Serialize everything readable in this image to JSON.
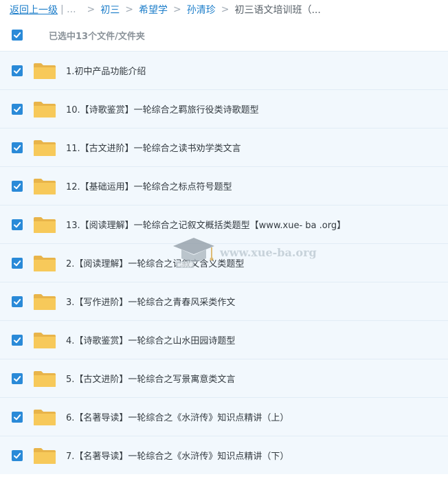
{
  "breadcrumb": {
    "back_label": "返回上一级",
    "ellipsis": "| ...",
    "sep": ">",
    "crumbs": [
      "初三",
      "希望学",
      "孙清珍"
    ],
    "current": "初三语文培训班（..."
  },
  "selection": {
    "label": "已选中13个文件/文件夹"
  },
  "files": [
    {
      "name": "1.初中产品功能介绍"
    },
    {
      "name": "10.【诗歌鉴赏】一轮综合之羁旅行役类诗歌题型"
    },
    {
      "name": "11.【古文进阶】一轮综合之读书劝学类文言"
    },
    {
      "name": "12.【基础运用】一轮综合之标点符号题型"
    },
    {
      "name": "13.【阅读理解】一轮综合之记叙文概括类题型【www.xue- ba .org】"
    },
    {
      "name": "2.【阅读理解】一轮综合之记叙文含义类题型"
    },
    {
      "name": "3.【写作进阶】一轮综合之青春风采类作文"
    },
    {
      "name": "4.【诗歌鉴赏】一轮综合之山水田园诗题型"
    },
    {
      "name": "5.【古文进阶】一轮综合之写景寓意类文言"
    },
    {
      "name": "6.【名著导读】一轮综合之《水浒传》知识点精讲（上）"
    },
    {
      "name": "7.【名著导读】一轮综合之《水浒传》知识点精讲（下）"
    }
  ],
  "watermark": {
    "text": "www.xue-ba.org"
  },
  "colors": {
    "accent": "#2a8ad8",
    "link": "#1a7cc9",
    "row_bg": "#f2f8fd",
    "folder": "#f7c95a"
  },
  "icons": {
    "check": "checkmark-icon",
    "folder": "folder-icon",
    "watermark": "graduation-cap-icon"
  }
}
